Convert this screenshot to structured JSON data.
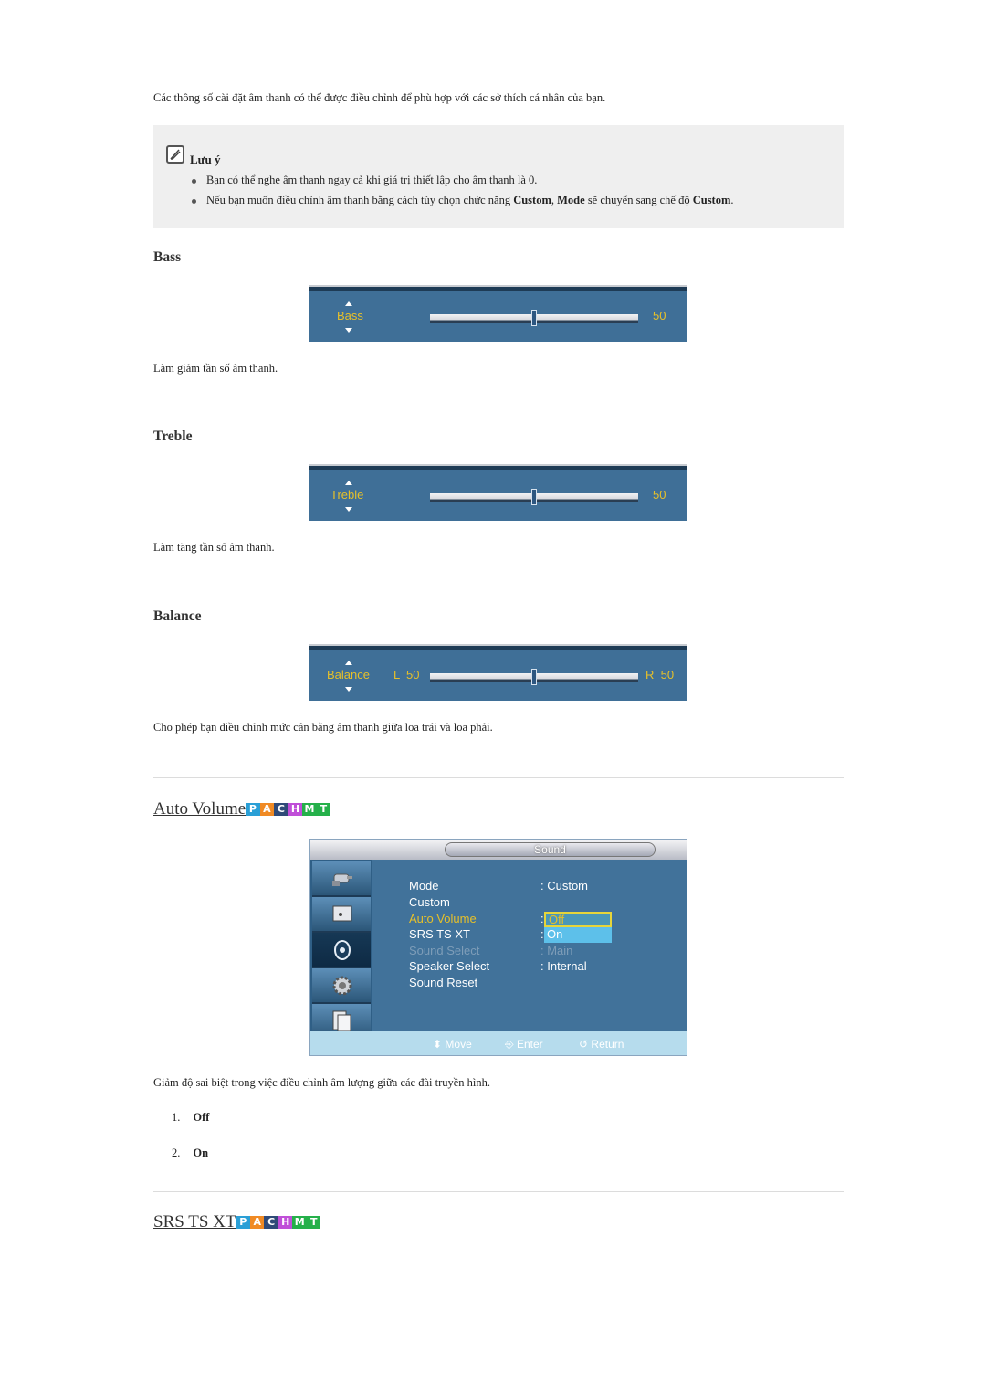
{
  "intro": "Các thông số cài đặt âm thanh có thể được điều chỉnh để phù hợp với các sở thích cá nhân của bạn.",
  "note": {
    "icon": "note-pencil-icon",
    "title": "Lưu ý",
    "items": [
      {
        "text": "Bạn có thể nghe âm thanh ngay cả khi giá trị thiết lập cho âm thanh là 0."
      },
      {
        "pre": "Nếu bạn muốn điều chỉnh âm thanh bằng cách tùy chọn chức năng ",
        "b1": "Custom",
        "mid1": ", ",
        "b2": "Mode",
        "mid2": " sẽ chuyển sang chế độ ",
        "b3": "Custom",
        "post": "."
      }
    ]
  },
  "sections": [
    {
      "heading": "Bass",
      "osd_label": "Bass",
      "value": 50,
      "value_text": "50",
      "description": "Làm giảm tần số âm thanh."
    },
    {
      "heading": "Treble",
      "osd_label": "Treble",
      "value": 50,
      "value_text": "50",
      "description": "Làm tăng tần số âm thanh."
    },
    {
      "heading": "Balance",
      "osd_label": "Balance",
      "left_text": "L  50",
      "right_text": "R  50",
      "value": 50,
      "description": "Cho phép bạn điều chỉnh mức cân bằng âm thanh giữa loa trái và loa phải."
    }
  ],
  "badges": [
    {
      "letter": "P",
      "color": "#2a9fd6"
    },
    {
      "letter": "A",
      "color": "#f08a24"
    },
    {
      "letter": "C",
      "color": "#2f4a78"
    },
    {
      "letter": "H",
      "color": "#c04fd8"
    },
    {
      "letter": "M",
      "color": "#25b04a"
    },
    {
      "letter": "T",
      "color": "#25b04a"
    }
  ],
  "auto_volume": {
    "heading": "Auto Volume",
    "menu": {
      "title": "Sound",
      "side_icons": [
        "input-plug-icon",
        "picture-icon",
        "sound-icon",
        "setup-gear-icon",
        "multi-window-icon"
      ],
      "rows": [
        {
          "label": "Mode",
          "value": ": Custom",
          "state": "normal"
        },
        {
          "label": "Custom",
          "value": "",
          "state": "normal"
        },
        {
          "label": "Auto Volume",
          "value": ":",
          "state": "highlight"
        },
        {
          "label": "SRS TS XT",
          "value": ":",
          "state": "normal"
        },
        {
          "label": "Sound Select",
          "value": ": Main",
          "state": "disabled"
        },
        {
          "label": "Speaker Select",
          "value": ": Internal",
          "state": "normal"
        },
        {
          "label": "Sound Reset",
          "value": "",
          "state": "normal"
        }
      ],
      "dropdown": [
        "Off",
        "On"
      ],
      "footer": {
        "move": "Move",
        "enter": "Enter",
        "return": "Return"
      }
    },
    "description": "Giảm độ sai biệt trong việc điều chỉnh âm lượng giữa các đài truyền hình.",
    "options": [
      {
        "num": "1.",
        "label": "Off"
      },
      {
        "num": "2.",
        "label": "On"
      }
    ]
  },
  "srs": {
    "heading": "SRS TS XT"
  }
}
